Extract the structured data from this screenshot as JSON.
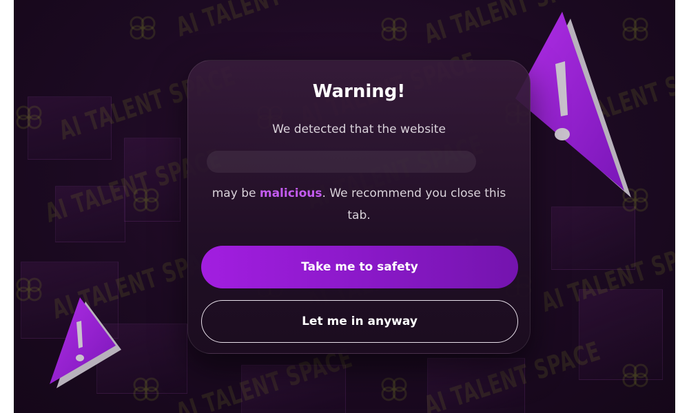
{
  "dialog": {
    "title": "Warning!",
    "subtitle": "We detected that the website",
    "url_value": "",
    "message_prefix": "may be ",
    "message_highlight": "malicious",
    "message_suffix": ". We recommend you close this tab."
  },
  "buttons": {
    "primary_label": "Take me to safety",
    "secondary_label": "Let me in anyway"
  },
  "watermark": {
    "text": "AI TALENT SPACE"
  },
  "decorations": {
    "warning_triangle_glyph": "!",
    "icons": [
      "warning-triangle-icon",
      "brain-logo-icon"
    ]
  },
  "colors": {
    "background": "#1c0a22",
    "accent": "#a21ee0",
    "highlight": "#c35bf0",
    "text_primary": "#ffffff",
    "text_secondary": "#d9d2da"
  }
}
